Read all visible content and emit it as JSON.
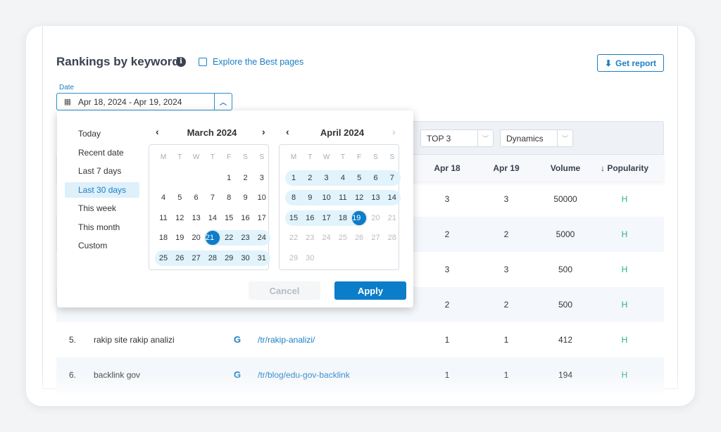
{
  "header": {
    "title": "Rankings by keywords",
    "info_icon": "info-icon",
    "explore_link": "Explore the Best pages",
    "get_report": "Get report"
  },
  "date_filter": {
    "label": "Date",
    "value": "Apr 18, 2024 - Apr 19, 2024"
  },
  "toolbar": {
    "top_select": "TOP 3",
    "view_select": "Dynamics"
  },
  "table": {
    "columns": [
      "Apr 18",
      "Apr 19",
      "Volume",
      "↓ Popularity"
    ],
    "rows": [
      {
        "num": "",
        "keyword": "",
        "url": "",
        "apr18": "3",
        "apr19": "3",
        "volume": "50000",
        "popularity": "H"
      },
      {
        "num": "",
        "keyword": "",
        "url": "",
        "apr18": "2",
        "apr19": "2",
        "volume": "5000",
        "popularity": "H"
      },
      {
        "num": "",
        "keyword": "",
        "url": "",
        "apr18": "3",
        "apr19": "3",
        "volume": "500",
        "popularity": "H"
      },
      {
        "num": "",
        "keyword": "",
        "url": "",
        "apr18": "2",
        "apr19": "2",
        "volume": "500",
        "popularity": "H"
      },
      {
        "num": "5.",
        "keyword": "rakip site rakip analizi",
        "engine": "G",
        "url": "/tr/rakip-analizi/",
        "apr18": "1",
        "apr19": "1",
        "volume": "412",
        "popularity": "H"
      },
      {
        "num": "6.",
        "keyword": "backlink gov",
        "engine": "G",
        "url": "/tr/blog/edu-gov-backlink",
        "apr18": "1",
        "apr19": "1",
        "volume": "194",
        "popularity": "H"
      }
    ]
  },
  "datepicker": {
    "presets": [
      "Today",
      "Recent date",
      "Last 7 days",
      "Last 30 days",
      "This week",
      "This month",
      "Custom"
    ],
    "active_preset": "Last 30 days",
    "weekdays": [
      "M",
      "T",
      "W",
      "T",
      "F",
      "S",
      "S"
    ],
    "months": [
      {
        "title": "March 2024",
        "first_weekday": 4,
        "days": 31,
        "range_from": 21,
        "range_to": 31,
        "selected": 21,
        "disabled_after": 31
      },
      {
        "title": "April 2024",
        "first_weekday": 0,
        "days": 30,
        "range_from": 1,
        "range_to": 19,
        "selected": 19,
        "disabled_after": 19
      }
    ],
    "cancel": "Cancel",
    "apply": "Apply"
  },
  "colors": {
    "accent": "#0b7dc9",
    "link": "#1b7fc4",
    "range": "#e1f3fc",
    "popularity_high": "#2bb673"
  }
}
